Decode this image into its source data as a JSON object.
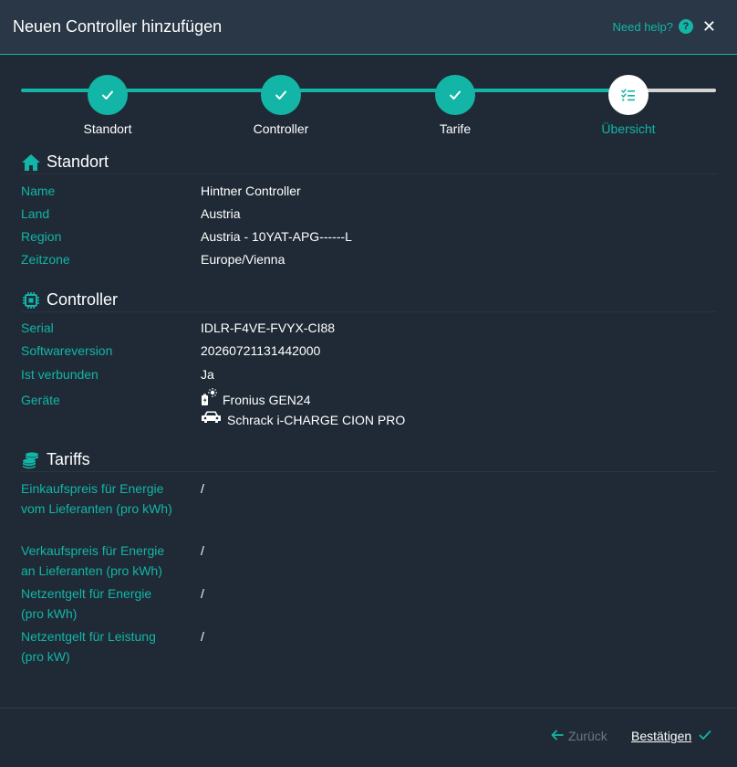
{
  "header": {
    "title": "Neuen Controller hinzufügen",
    "help_label": "Need help?",
    "help_icon": "?",
    "close_icon": "✕"
  },
  "stepper": {
    "steps": [
      {
        "label": "Standort",
        "state": "done"
      },
      {
        "label": "Controller",
        "state": "done"
      },
      {
        "label": "Tarife",
        "state": "done"
      },
      {
        "label": "Übersicht",
        "state": "current"
      }
    ]
  },
  "standort": {
    "title": "Standort",
    "rows": [
      {
        "key": "Name",
        "value": "Hintner Controller"
      },
      {
        "key": "Land",
        "value": "Austria"
      },
      {
        "key": "Region",
        "value": "Austria - 10YAT-APG------L"
      },
      {
        "key": "Zeitzone",
        "value": "Europe/Vienna"
      }
    ]
  },
  "controller": {
    "title": "Controller",
    "rows": [
      {
        "key": "Serial",
        "value": "IDLR-F4VE-FVYX-CI88"
      },
      {
        "key": "Softwareversion",
        "value": "20260721131442000"
      },
      {
        "key": "Ist verbunden",
        "value": "Ja"
      }
    ],
    "devices_key": "Geräte",
    "devices": [
      {
        "name": "Fronius GEN24",
        "icon": "solar-battery-icon"
      },
      {
        "name": "Schrack i-CHARGE CION PRO",
        "icon": "car-icon"
      }
    ]
  },
  "tariffs": {
    "title": "Tariffs",
    "rows": [
      {
        "key": "Einkaufspreis für Energie vom Lieferanten (pro kWh)",
        "value": "/"
      },
      {
        "key": "Verkaufspreis für Energie an Lieferanten (pro kWh)",
        "value": "/"
      },
      {
        "key": "Netzentgelt für Energie (pro kWh)",
        "value": "/"
      },
      {
        "key": "Netzentgelt für Leistung (pro kW)",
        "value": "/"
      }
    ]
  },
  "footer": {
    "back_label": "Zurück",
    "confirm_label": "Bestätigen"
  },
  "colors": {
    "accent": "#13b5a6",
    "background": "#1f2a36",
    "header": "#293746",
    "muted": "#6b7885"
  }
}
